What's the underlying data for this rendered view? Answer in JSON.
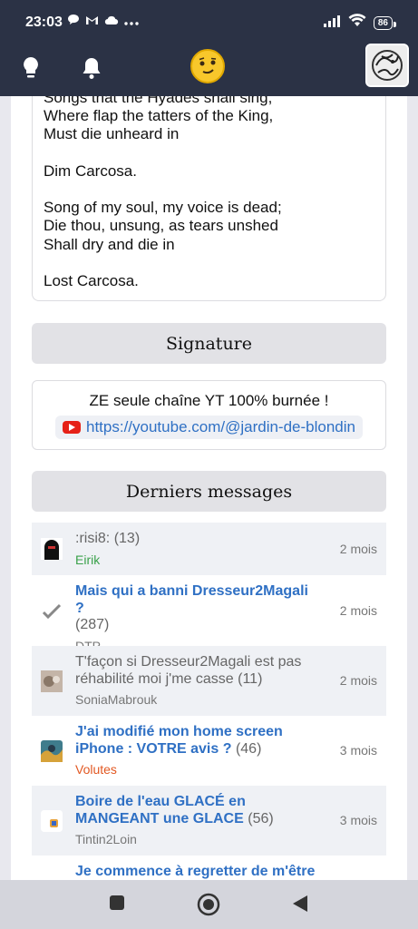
{
  "status": {
    "time": "23:03",
    "battery": "86"
  },
  "colors": {
    "bar": "#2b3245",
    "link": "#2f70c4",
    "author_green": "#3aa14a",
    "author_red": "#e25822"
  },
  "icons": {
    "app_left": [
      "lightbulb-icon",
      "bell-icon"
    ],
    "center": "smirk-emoji-icon",
    "right": "profile-avatar-icon"
  },
  "poem": {
    "lines": [
      "Songs that the Hyades shall sing,",
      "Where flap the tatters of the King,",
      "Must die unheard in",
      "",
      "Dim Carcosa.",
      "",
      "Song of my soul, my voice is dead;",
      "Die thou, unsung, as tears unshed",
      "Shall dry and die in",
      "",
      "Lost Carcosa."
    ]
  },
  "signature": {
    "title": "Signature",
    "text": "ZE seule chaîne YT 100% burnée !",
    "link": "https://youtube.com/@jardin-de-blondin"
  },
  "latest": {
    "title": "Derniers messages",
    "items": [
      {
        "title": ":risi8:",
        "count": "(13)",
        "author": "Eirik",
        "time": "2 mois"
      },
      {
        "title": "Mais qui a banni Dresseur2Magali ?",
        "count": "(287)",
        "author": "DTP",
        "time": "2 mois"
      },
      {
        "title": "T'façon si Dresseur2Magali est pas réhabilité moi j'me casse",
        "count": "(11)",
        "author": "SoniaMabrouk",
        "time": "2 mois"
      },
      {
        "title": "J'ai modifié mon home screen iPhone : VOTRE avis ?",
        "count": "(46)",
        "author": "Volutes",
        "time": "3 mois"
      },
      {
        "title": "Boire de l'eau GLACÉ en MANGEANT une GLACE",
        "count": "(56)",
        "author": "Tintin2Loin",
        "time": "3 mois"
      },
      {
        "title": "Je commence à regretter de m'être"
      }
    ]
  }
}
